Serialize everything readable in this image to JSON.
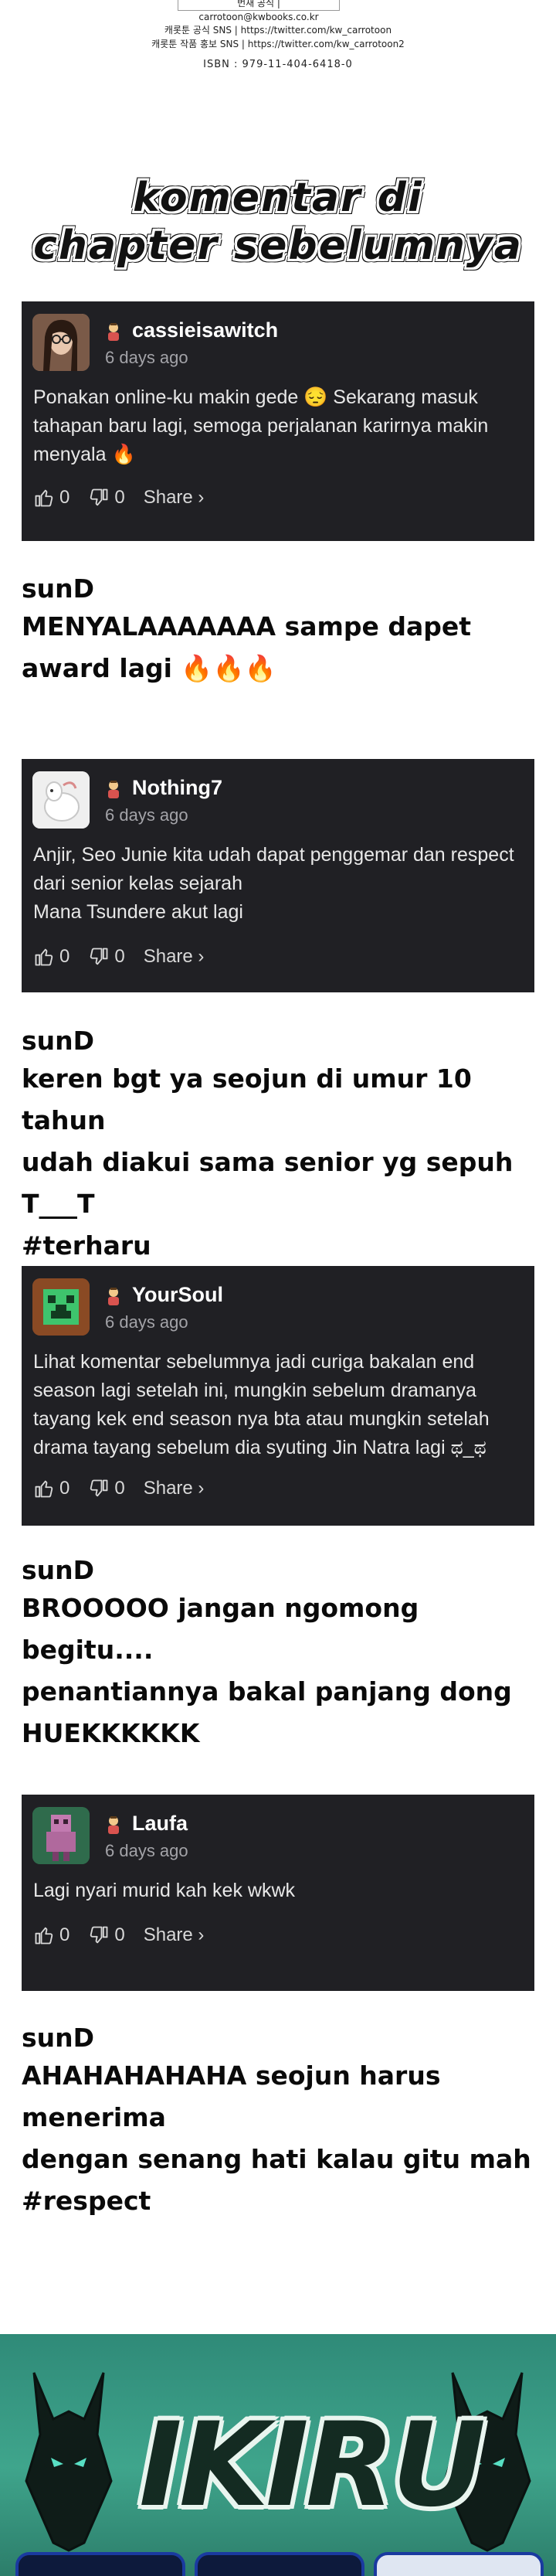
{
  "credits": {
    "box_text": "번새 공식  |  carrotoon@kwbooks.co.kr",
    "sns_official": "캐롯툰 공식 SNS | https://twitter.com/kw_carrotoon",
    "sns_promo": "캐롯툰 작품 홍보 SNS | https://twitter.com/kw_carrotoon2",
    "isbn": "ISBN : 979-11-404-6418-0"
  },
  "heading": {
    "line1": "komentar di",
    "line2": "chapter sebelumnya"
  },
  "comments": [
    {
      "username": "cassieisawitch",
      "time": "6 days ago",
      "body": "Ponakan online-ku makin gede 😔 Sekarang masuk tahapan baru lagi, semoga perjalanan karirnya makin menyala 🔥",
      "likes": "0",
      "dislikes": "0",
      "share": "Share ›",
      "avatar_icon": "woman-glasses-avatar"
    },
    {
      "username": "Nothing7",
      "time": "6 days ago",
      "body": "Anjir, Seo Junie kita udah dapat penggemar dan respect dari senior kelas sejarah\nMana Tsundere akut lagi",
      "likes": "0",
      "dislikes": "0",
      "share": "Share ›",
      "avatar_icon": "white-creature-avatar"
    },
    {
      "username": "YourSoul",
      "time": "6 days ago",
      "body": "Lihat komentar sebelumnya jadi curiga bakalan end season lagi setelah ini, mungkin sebelum dramanya tayang kek end season nya bta atau mungkin setelah drama tayang sebelum dia syuting Jin Natra lagi ಥ_ಥ",
      "likes": "0",
      "dislikes": "0",
      "share": "Share ›",
      "avatar_icon": "pixel-creeper-avatar"
    },
    {
      "username": "Laufa",
      "time": "6 days ago",
      "body": "Lagi nyari murid kah kek wkwk",
      "likes": "0",
      "dislikes": "0",
      "share": "Share ›",
      "avatar_icon": "pixel-figure-avatar"
    }
  ],
  "replies": [
    {
      "who": "sunD",
      "text": "MENYALAAAAAAA sampe dapet\n award lagi 🔥🔥🔥"
    },
    {
      "who": "sunD",
      "text": "keren bgt ya seojun di umur 10 tahun\nudah diakui sama senior yg sepuh T___T\n#terharu"
    },
    {
      "who": "sunD",
      "text": "BROOOOO jangan ngomong begitu....\npenantiannya bakal panjang dong\nHUEKKKKKK"
    },
    {
      "who": "sunD",
      "text": "AHAHAHAHAHA seojun harus menerima\ndengan senang hati kalau gitu mah\n#respect"
    }
  ],
  "banner": {
    "wordmark": "IKIRU",
    "colors": {
      "bg": "#3fa58c",
      "ink": "#142b22",
      "tab_border": "#1a3aa0"
    }
  }
}
